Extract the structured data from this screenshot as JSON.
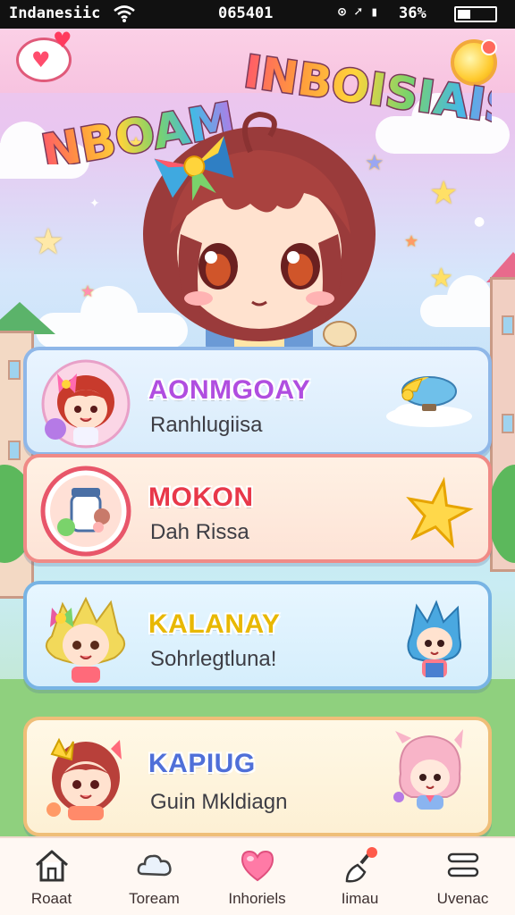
{
  "status_bar": {
    "carrier": "Indanesiic",
    "time": "065401",
    "battery_percent": "36%",
    "battery_level": 0.36,
    "icons": [
      "wifi-icon",
      "alarm-icon",
      "location-icon",
      "signal-icon"
    ]
  },
  "header": {
    "title_word_1": "NBOAM",
    "title_word_2": "INBOISIAIS",
    "left_icon": "heart-bubble-icon",
    "right_icon": "coin-icon"
  },
  "colors": {
    "title_palette": [
      "#ff5a6a",
      "#ff9a3c",
      "#ffd43b",
      "#7ad36b",
      "#45b8e6",
      "#b57ae6"
    ],
    "card_borders": [
      "#8fb7e8",
      "#f08a86",
      "#78b4e4",
      "#efbe78"
    ]
  },
  "cards": [
    {
      "title": "AONMGOAY",
      "subtitle": "Ranhlugiisa",
      "title_color": "#b04ee0",
      "accessory": "blimp-icon"
    },
    {
      "title": "MOKON",
      "subtitle": "Dah Rissa",
      "title_color": "#e8384a",
      "accessory": "star-icon"
    },
    {
      "title": "KALANAY",
      "subtitle": "Sohrlegtluna!",
      "title_color": "#e8b800",
      "accessory": "blue-hair-character"
    },
    {
      "title": "KAPIUG",
      "subtitle": "Guin Mkldiagn",
      "title_color": "#4f6fd8",
      "accessory": "pink-hair-character"
    }
  ],
  "nav": [
    {
      "label": "Roaat",
      "icon": "home-icon"
    },
    {
      "label": "Toream",
      "icon": "cloud-icon"
    },
    {
      "label": "Inhoriels",
      "icon": "heart-icon",
      "active": true
    },
    {
      "label": "Iimau",
      "icon": "brush-icon"
    },
    {
      "label": "Uvenac",
      "icon": "menu-icon"
    }
  ]
}
